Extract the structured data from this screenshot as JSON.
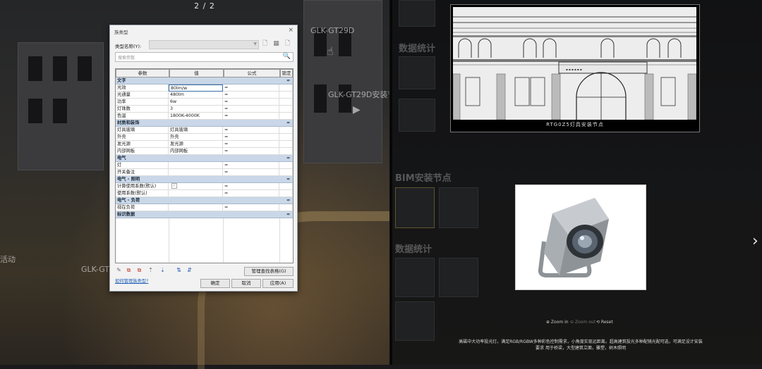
{
  "page_counter": "2 / 2",
  "background": {
    "left_labels": {
      "tag_top": "GLK-GT29D",
      "tag_mid": "GLK-GT29D安装节点",
      "tag_left": "GLK-GT75D",
      "tag_partial": "活动"
    },
    "right_headings": {
      "stats_top": "数据统计",
      "bim_nodes": "BIM安装节点",
      "stats_bottom": "数据统计"
    }
  },
  "dialog": {
    "title": "族类型",
    "close": "×",
    "type_name_label": "类型名称(Y):",
    "type_name_value": "",
    "search_placeholder": "搜索参数",
    "headers": [
      "参数",
      "值",
      "公式",
      "锁定"
    ],
    "groups": [
      {
        "name": "文字",
        "rows": [
          {
            "param": "光效",
            "value": "80lm/w",
            "formula": "=",
            "editing": true
          },
          {
            "param": "光通量",
            "value": "480lm",
            "formula": "="
          },
          {
            "param": "功率",
            "value": "6w",
            "formula": "="
          },
          {
            "param": "灯珠数",
            "value": "3",
            "formula": "="
          },
          {
            "param": "色温",
            "value": "1800K-4000K",
            "formula": "="
          }
        ]
      },
      {
        "name": "材质和装饰",
        "rows": [
          {
            "param": "灯具玻璃",
            "value": "灯具玻璃",
            "formula": "="
          },
          {
            "param": "外壳",
            "value": "外壳",
            "formula": "="
          },
          {
            "param": "发光源",
            "value": "发光源",
            "formula": "="
          },
          {
            "param": "内部网板",
            "value": "内部网板",
            "formula": "="
          }
        ]
      },
      {
        "name": "电气",
        "rows": [
          {
            "param": "灯",
            "value": "",
            "formula": "="
          },
          {
            "param": "开关备注",
            "value": "",
            "formula": "="
          }
        ]
      },
      {
        "name": "电气 - 照明",
        "rows": [
          {
            "param": "计算使用系数(默认)",
            "value": "",
            "formula": "=",
            "checkbox": true
          },
          {
            "param": "使用系数(默认)",
            "value": "",
            "formula": "="
          }
        ]
      },
      {
        "name": "电气 - 负荷",
        "rows": [
          {
            "param": "视在负荷",
            "value": "",
            "formula": "="
          }
        ]
      },
      {
        "name": "标识数据",
        "rows": []
      }
    ],
    "toggle_glyph": "≈",
    "manage_lookup_label": "管理查找表格(G)",
    "help_link": "如何管理族类型?",
    "ok_label": "确定",
    "cancel_label": "取消",
    "apply_label": "应用(A)"
  },
  "cad": {
    "caption": "RTG0Z5灯具安装节点"
  },
  "photo": {
    "zoom_in": "⊕ Zoom in",
    "zoom_out": "⊖ Zoom out",
    "reset": "⟲ Reset",
    "description": "高磁中大功率投光灯。满足RGB/RGBW多种彩色控制需求，小角度实现远距离。超高建筑投光多种配镜光配可选，可满足设计安装要求 用于桥梁，大型建筑立面，雕塑，树木照明",
    "next": "›"
  }
}
